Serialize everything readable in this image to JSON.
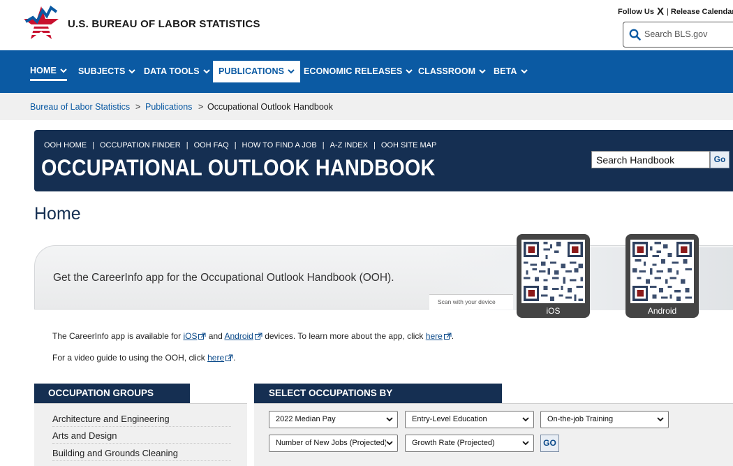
{
  "header": {
    "site_name": "U.S. BUREAU OF LABOR STATISTICS",
    "follow_us": "Follow Us",
    "follow_icon": "X",
    "release_calendar": "Release Calendar",
    "search_placeholder": "Search BLS.gov"
  },
  "nav": {
    "items": [
      {
        "label": "HOME"
      },
      {
        "label": "SUBJECTS"
      },
      {
        "label": "DATA TOOLS"
      },
      {
        "label": "PUBLICATIONS"
      },
      {
        "label": "ECONOMIC RELEASES"
      },
      {
        "label": "CLASSROOM"
      },
      {
        "label": "BETA"
      }
    ]
  },
  "breadcrumb": {
    "items": [
      "Bureau of Labor Statistics",
      "Publications",
      "Occupational Outlook Handbook"
    ],
    "separator": ">"
  },
  "ooh": {
    "subnav": [
      "OOH HOME",
      "OCCUPATION FINDER",
      "OOH FAQ",
      "HOW TO FIND A JOB",
      "A-Z INDEX",
      "OOH SITE MAP"
    ],
    "title": "OCCUPATIONAL OUTLOOK HANDBOOK",
    "search_value": "Search Handbook",
    "go_label": "Go"
  },
  "page": {
    "title": "Home"
  },
  "app_promo": {
    "text": "Get the CareerInfo app for the Occupational Outlook Handbook (OOH).",
    "scan_text": "Scan with your device",
    "qr_ios_label": "iOS",
    "qr_android_label": "Android"
  },
  "info": {
    "line1_a": "The CareerInfo app is available for ",
    "line1_ios": "iOS",
    "line1_b": " and ",
    "line1_android": "Android",
    "line1_c": " devices. To learn more about the app, click ",
    "line1_here": "here",
    "line1_end": ".",
    "line2_a": "For a video guide to using the OOH, click ",
    "line2_here": "here",
    "line2_end": "."
  },
  "occupation_groups": {
    "heading": "OCCUPATION GROUPS",
    "items": [
      "Architecture and Engineering",
      "Arts and Design",
      "Building and Grounds Cleaning"
    ]
  },
  "select_by": {
    "heading": "SELECT OCCUPATIONS BY",
    "selects": [
      "2022 Median Pay",
      "Entry-Level Education",
      "On-the-job Training",
      "Number of New Jobs (Projected)",
      "Growth Rate (Projected)"
    ],
    "go_label": "GO"
  },
  "colors": {
    "nav_blue": "#0b5aa3",
    "banner_navy": "#152f52",
    "breadcrumb_bg": "#f0f0f0",
    "link_blue": "#0b4a8a"
  }
}
